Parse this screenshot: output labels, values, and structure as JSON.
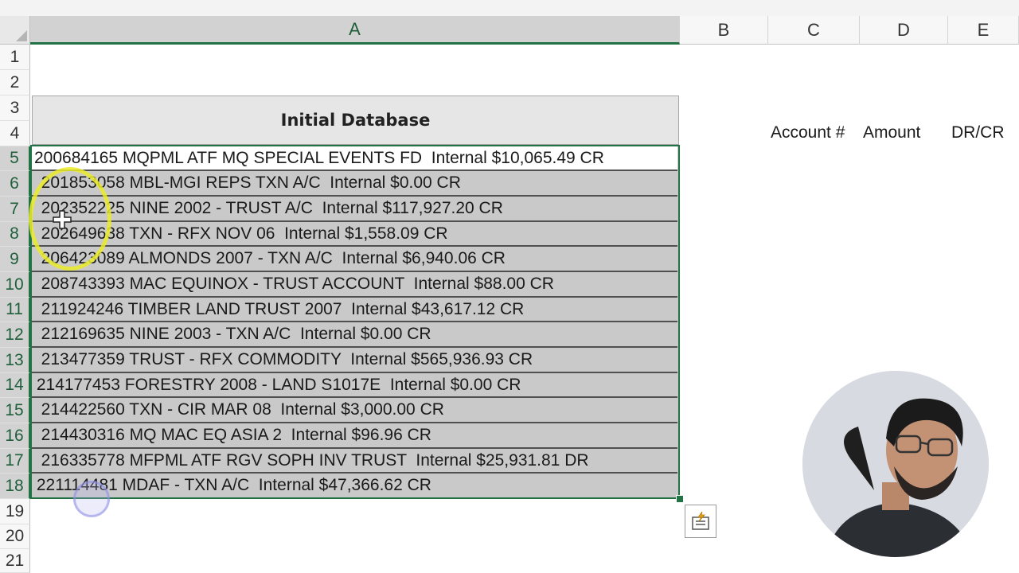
{
  "sheet": {
    "columns": [
      "A",
      "B",
      "C",
      "D",
      "E"
    ],
    "rows": [
      "1",
      "2",
      "3",
      "4",
      "5",
      "6",
      "7",
      "8",
      "9",
      "10",
      "11",
      "12",
      "13",
      "14",
      "15",
      "16",
      "17",
      "18",
      "19",
      "20",
      "21"
    ],
    "title": "Initial Database",
    "side_headers": {
      "account": "Account #",
      "amount": "Amount",
      "drcr": "DR/CR"
    },
    "data_rows": [
      "200684165 MQPML ATF MQ SPECIAL EVENTS FD  Internal $10,065.49 CR",
      "  201853058 MBL-MGI REPS TXN A/C  Internal $0.00 CR",
      "  202352225 NINE 2002 - TRUST A/C  Internal $117,927.20 CR",
      "  202649638 TXN - RFX NOV 06  Internal $1,558.09 CR",
      "  206423089 ALMONDS 2007 - TXN A/C  Internal $6,940.06 CR",
      "  208743393 MAC EQUINOX - TRUST ACCOUNT  Internal $88.00 CR",
      "  211924246 TIMBER LAND TRUST 2007  Internal $43,617.12 CR",
      "  212169635 NINE 2003 - TXN A/C  Internal $0.00 CR",
      "  213477359 TRUST - RFX COMMODITY  Internal $565,936.93 CR",
      " 214177453 FORESTRY 2008 - LAND S1017E  Internal $0.00 CR",
      "  214422560 TXN - CIR MAR 08  Internal $3,000.00 CR",
      "  214430316 MQ MAC EQ ASIA 2  Internal $96.96 CR",
      "  216335778 MFPML ATF RGV SOPH INV TRUST  Internal $25,931.81 DR",
      " 221114481 MDAF - TXN A/C  Internal $47,366.62 CR"
    ]
  },
  "icons": {
    "quick_analysis": "quick-analysis-icon",
    "select_all": "select-all-triangle-icon",
    "cursor": "crosshair-cursor-icon"
  },
  "colors": {
    "selection_green": "#217346",
    "header_gray": "#f7f7f7",
    "selected_fill": "#c9c9c9"
  }
}
